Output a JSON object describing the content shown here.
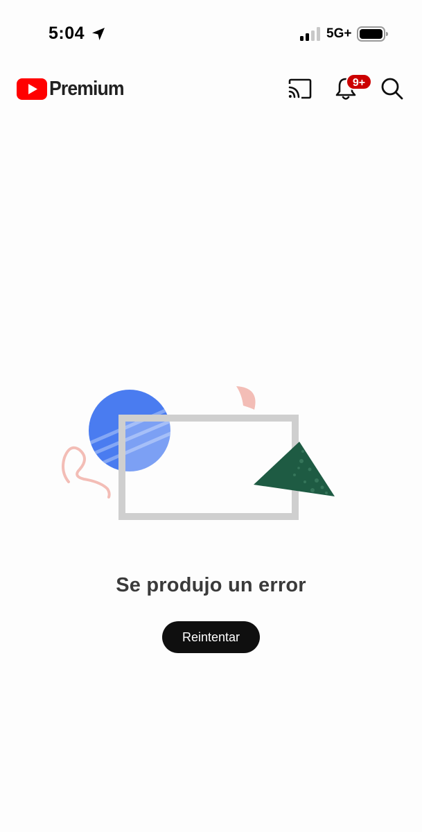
{
  "status_bar": {
    "time": "5:04",
    "network": "5G+",
    "icons": [
      "location-arrow-icon",
      "signal-bars-icon",
      "battery-icon"
    ]
  },
  "header": {
    "brand": "Premium",
    "icons": [
      "youtube-logo-icon",
      "cast-icon",
      "bell-icon",
      "search-icon"
    ],
    "notification_badge": "9+",
    "colors": {
      "brand_red": "#ff0000",
      "badge_red": "#cc0000"
    }
  },
  "error": {
    "message": "Se produjo un error",
    "retry_label": "Reintentar"
  },
  "illustration": {
    "colors": {
      "circle_blue": "#4a7cf0",
      "frame_gray": "#cfcfcf",
      "triangle_green": "#1e5b43",
      "accent_pink": "#f3bdb6"
    }
  }
}
